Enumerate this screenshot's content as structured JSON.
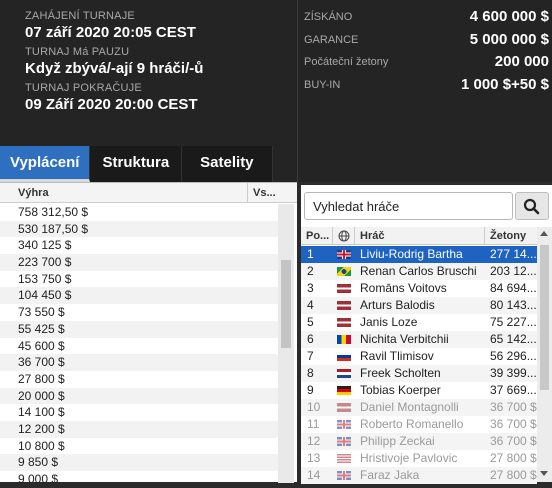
{
  "tournament": {
    "start_label": "ZAHÁJENÍ TURNAJE",
    "start_value": "07 září 2020  20:05 CEST",
    "pause_label": "TURNAJ Má PAUZU",
    "pause_value": "Když zbývá/-ají 9 hráči/-ů",
    "resume_label": "TURNAJ POKRAČUJE",
    "resume_value": "09 Září 2020  20:00 CEST"
  },
  "stats": [
    {
      "label": "ZÍSKÁNO",
      "value": "4 600 000 $"
    },
    {
      "label": "GARANCE",
      "value": "5 000 000 $"
    },
    {
      "label": "Počáteční žetony",
      "value": "200 000"
    },
    {
      "label": "BUY-IN",
      "value": "1 000 $+50 $"
    }
  ],
  "tabs": [
    "Vyplácení",
    "Struktura",
    "Satelity"
  ],
  "payouts": {
    "col_prize": "Výhra",
    "col_other": "Vs...",
    "rows": [
      "758 312,50 $",
      "530 187,50 $",
      "340 125 $",
      "223 700 $",
      "153 750 $",
      "104 450 $",
      "73 550 $",
      "55 425 $",
      "45 600 $",
      "36 700 $",
      "27 800 $",
      "20 000 $",
      "14 100 $",
      "12 200 $",
      "10 800 $",
      "9 850 $",
      "9 000 $"
    ]
  },
  "players": {
    "search_placeholder": "Vyhledat hráče",
    "col_pos": "Po...",
    "col_player": "Hráč",
    "col_chips": "Žetony",
    "rows": [
      {
        "pos": "1",
        "flag": "uk",
        "name": "Liviu-Rodrig Bartha",
        "chips": "277 14..."
      },
      {
        "pos": "2",
        "flag": "br",
        "name": "Renan Carlos Bruschi",
        "chips": "203 12..."
      },
      {
        "pos": "3",
        "flag": "lv",
        "name": "Romāns Voitovs",
        "chips": "84 694..."
      },
      {
        "pos": "4",
        "flag": "lv",
        "name": "Arturs Balodis",
        "chips": "80 143..."
      },
      {
        "pos": "5",
        "flag": "lv",
        "name": "Janis Loze",
        "chips": "75 227..."
      },
      {
        "pos": "6",
        "flag": "md",
        "name": "Nichita Verbitchii",
        "chips": "65 142..."
      },
      {
        "pos": "7",
        "flag": "ru",
        "name": "Ravil Tlimisov",
        "chips": "56 296..."
      },
      {
        "pos": "8",
        "flag": "nl",
        "name": "Freek Scholten",
        "chips": "39 399..."
      },
      {
        "pos": "9",
        "flag": "de",
        "name": "Tobias Koerper",
        "chips": "37 669..."
      },
      {
        "pos": "10",
        "flag": "lv",
        "name": "Daniel Montagnolli",
        "chips": "36 700 $"
      },
      {
        "pos": "11",
        "flag": "uk",
        "name": "Roberto Romanello",
        "chips": "36 700 $"
      },
      {
        "pos": "12",
        "flag": "uk",
        "name": "Philipp Zeckai",
        "chips": "36 700 $"
      },
      {
        "pos": "13",
        "flag": "us",
        "name": "Hristivoje Pavlovic",
        "chips": "27 800 $"
      },
      {
        "pos": "14",
        "flag": "uk",
        "name": "Faraz Jaka",
        "chips": "27 800 $"
      }
    ]
  },
  "colors": {
    "accent": "#2f6fbf",
    "selected_row": "#1e63c2"
  }
}
